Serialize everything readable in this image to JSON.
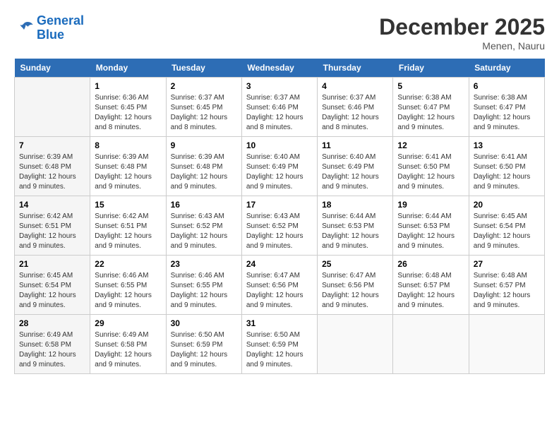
{
  "logo": {
    "line1": "General",
    "line2": "Blue"
  },
  "title": "December 2025",
  "subtitle": "Menen, Nauru",
  "header": {
    "days": [
      "Sunday",
      "Monday",
      "Tuesday",
      "Wednesday",
      "Thursday",
      "Friday",
      "Saturday"
    ]
  },
  "weeks": [
    [
      {
        "day": "",
        "info": ""
      },
      {
        "day": "1",
        "info": "Sunrise: 6:36 AM\nSunset: 6:45 PM\nDaylight: 12 hours\nand 8 minutes."
      },
      {
        "day": "2",
        "info": "Sunrise: 6:37 AM\nSunset: 6:45 PM\nDaylight: 12 hours\nand 8 minutes."
      },
      {
        "day": "3",
        "info": "Sunrise: 6:37 AM\nSunset: 6:46 PM\nDaylight: 12 hours\nand 8 minutes."
      },
      {
        "day": "4",
        "info": "Sunrise: 6:37 AM\nSunset: 6:46 PM\nDaylight: 12 hours\nand 8 minutes."
      },
      {
        "day": "5",
        "info": "Sunrise: 6:38 AM\nSunset: 6:47 PM\nDaylight: 12 hours\nand 9 minutes."
      },
      {
        "day": "6",
        "info": "Sunrise: 6:38 AM\nSunset: 6:47 PM\nDaylight: 12 hours\nand 9 minutes."
      }
    ],
    [
      {
        "day": "7",
        "info": "Sunrise: 6:39 AM\nSunset: 6:48 PM\nDaylight: 12 hours\nand 9 minutes."
      },
      {
        "day": "8",
        "info": "Sunrise: 6:39 AM\nSunset: 6:48 PM\nDaylight: 12 hours\nand 9 minutes."
      },
      {
        "day": "9",
        "info": "Sunrise: 6:39 AM\nSunset: 6:48 PM\nDaylight: 12 hours\nand 9 minutes."
      },
      {
        "day": "10",
        "info": "Sunrise: 6:40 AM\nSunset: 6:49 PM\nDaylight: 12 hours\nand 9 minutes."
      },
      {
        "day": "11",
        "info": "Sunrise: 6:40 AM\nSunset: 6:49 PM\nDaylight: 12 hours\nand 9 minutes."
      },
      {
        "day": "12",
        "info": "Sunrise: 6:41 AM\nSunset: 6:50 PM\nDaylight: 12 hours\nand 9 minutes."
      },
      {
        "day": "13",
        "info": "Sunrise: 6:41 AM\nSunset: 6:50 PM\nDaylight: 12 hours\nand 9 minutes."
      }
    ],
    [
      {
        "day": "14",
        "info": "Sunrise: 6:42 AM\nSunset: 6:51 PM\nDaylight: 12 hours\nand 9 minutes."
      },
      {
        "day": "15",
        "info": "Sunrise: 6:42 AM\nSunset: 6:51 PM\nDaylight: 12 hours\nand 9 minutes."
      },
      {
        "day": "16",
        "info": "Sunrise: 6:43 AM\nSunset: 6:52 PM\nDaylight: 12 hours\nand 9 minutes."
      },
      {
        "day": "17",
        "info": "Sunrise: 6:43 AM\nSunset: 6:52 PM\nDaylight: 12 hours\nand 9 minutes."
      },
      {
        "day": "18",
        "info": "Sunrise: 6:44 AM\nSunset: 6:53 PM\nDaylight: 12 hours\nand 9 minutes."
      },
      {
        "day": "19",
        "info": "Sunrise: 6:44 AM\nSunset: 6:53 PM\nDaylight: 12 hours\nand 9 minutes."
      },
      {
        "day": "20",
        "info": "Sunrise: 6:45 AM\nSunset: 6:54 PM\nDaylight: 12 hours\nand 9 minutes."
      }
    ],
    [
      {
        "day": "21",
        "info": "Sunrise: 6:45 AM\nSunset: 6:54 PM\nDaylight: 12 hours\nand 9 minutes."
      },
      {
        "day": "22",
        "info": "Sunrise: 6:46 AM\nSunset: 6:55 PM\nDaylight: 12 hours\nand 9 minutes."
      },
      {
        "day": "23",
        "info": "Sunrise: 6:46 AM\nSunset: 6:55 PM\nDaylight: 12 hours\nand 9 minutes."
      },
      {
        "day": "24",
        "info": "Sunrise: 6:47 AM\nSunset: 6:56 PM\nDaylight: 12 hours\nand 9 minutes."
      },
      {
        "day": "25",
        "info": "Sunrise: 6:47 AM\nSunset: 6:56 PM\nDaylight: 12 hours\nand 9 minutes."
      },
      {
        "day": "26",
        "info": "Sunrise: 6:48 AM\nSunset: 6:57 PM\nDaylight: 12 hours\nand 9 minutes."
      },
      {
        "day": "27",
        "info": "Sunrise: 6:48 AM\nSunset: 6:57 PM\nDaylight: 12 hours\nand 9 minutes."
      }
    ],
    [
      {
        "day": "28",
        "info": "Sunrise: 6:49 AM\nSunset: 6:58 PM\nDaylight: 12 hours\nand 9 minutes."
      },
      {
        "day": "29",
        "info": "Sunrise: 6:49 AM\nSunset: 6:58 PM\nDaylight: 12 hours\nand 9 minutes."
      },
      {
        "day": "30",
        "info": "Sunrise: 6:50 AM\nSunset: 6:59 PM\nDaylight: 12 hours\nand 9 minutes."
      },
      {
        "day": "31",
        "info": "Sunrise: 6:50 AM\nSunset: 6:59 PM\nDaylight: 12 hours\nand 9 minutes."
      },
      {
        "day": "",
        "info": ""
      },
      {
        "day": "",
        "info": ""
      },
      {
        "day": "",
        "info": ""
      }
    ]
  ]
}
